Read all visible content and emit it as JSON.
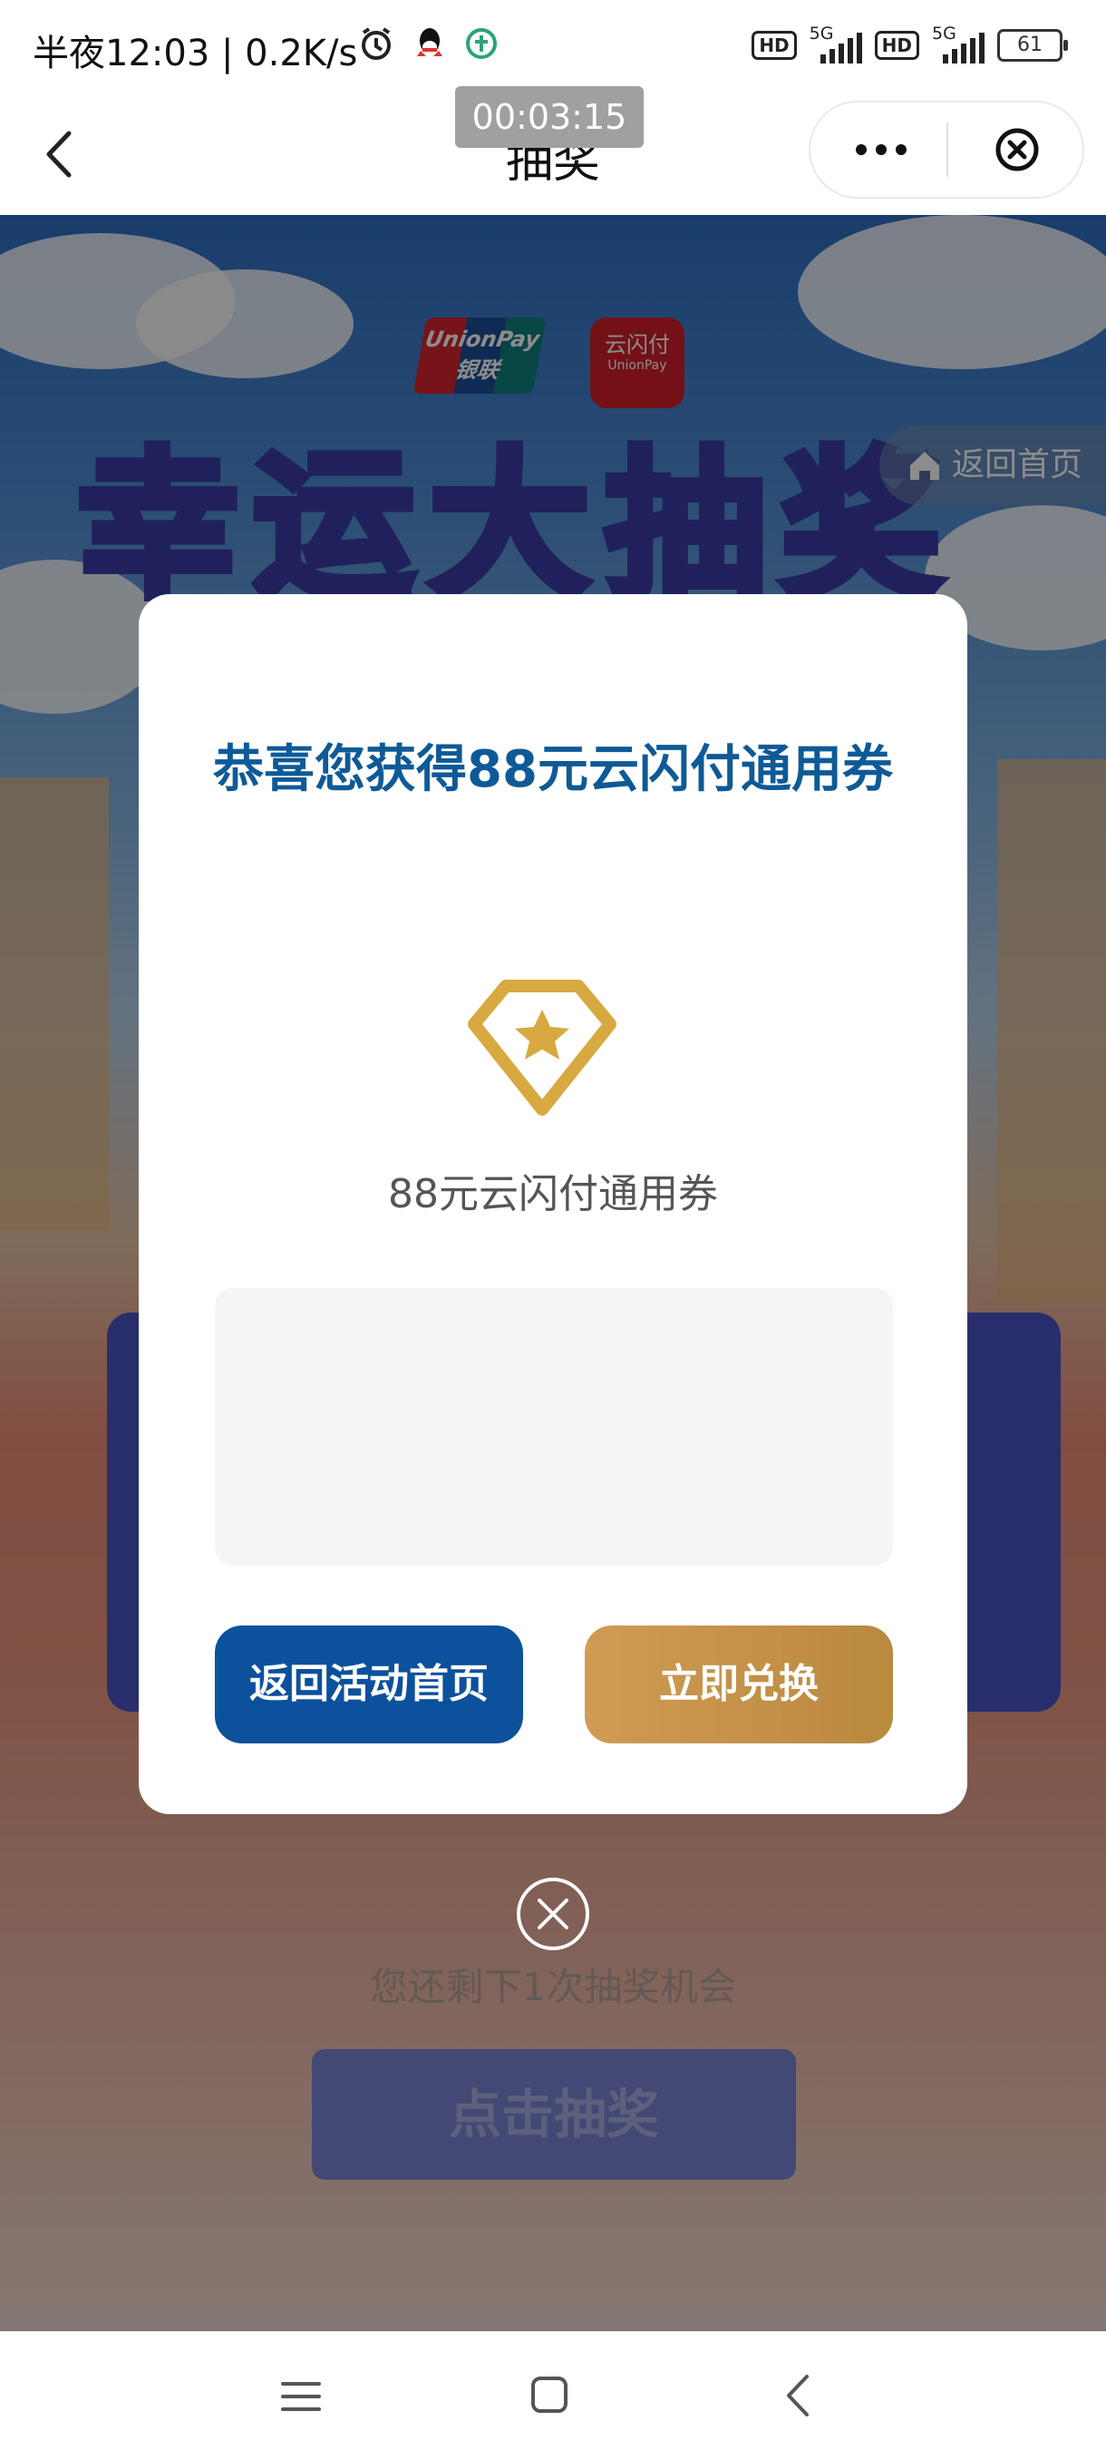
{
  "status_bar": {
    "time_and_speed": "半夜12:03 | 0.2K/s",
    "network_1": "5G",
    "network_2": "5G",
    "hd_label": "HD",
    "battery": "61",
    "icons": [
      "alarm-icon",
      "qq-icon",
      "app-notification-icon"
    ]
  },
  "titlebar": {
    "title": "抽奖",
    "timer": "00:03:15",
    "icons": [
      "back-chevron-icon",
      "more-dots-icon",
      "close-circle-icon"
    ]
  },
  "background": {
    "logo_unionpay_top": "UnionPay",
    "logo_unionpay_bottom": "银联",
    "logo_yunshanfu_top": "云闪付",
    "logo_yunshanfu_bottom": "UnionPay",
    "banner_title": "幸运大抽奖",
    "return_home": "返回首页",
    "chances_text": "您还剩下1次抽奖机会",
    "draw_button": "点击抽奖"
  },
  "modal": {
    "title": "恭喜您获得88元云闪付通用券",
    "prize_icon": "diamond-star-icon",
    "prize_name": "88元云闪付通用券",
    "code_area": "",
    "back_button": "返回活动首页",
    "redeem_button": "立即兑换",
    "close_icon": "close-circle-icon"
  },
  "colors": {
    "title_blue": "#0e5a97",
    "primary_button": "#0c519c",
    "gold_button": "#c89547",
    "gold_icon": "#d8a940"
  },
  "navbar": {
    "icons": [
      "menu-icon",
      "home-square-icon",
      "back-icon"
    ]
  }
}
